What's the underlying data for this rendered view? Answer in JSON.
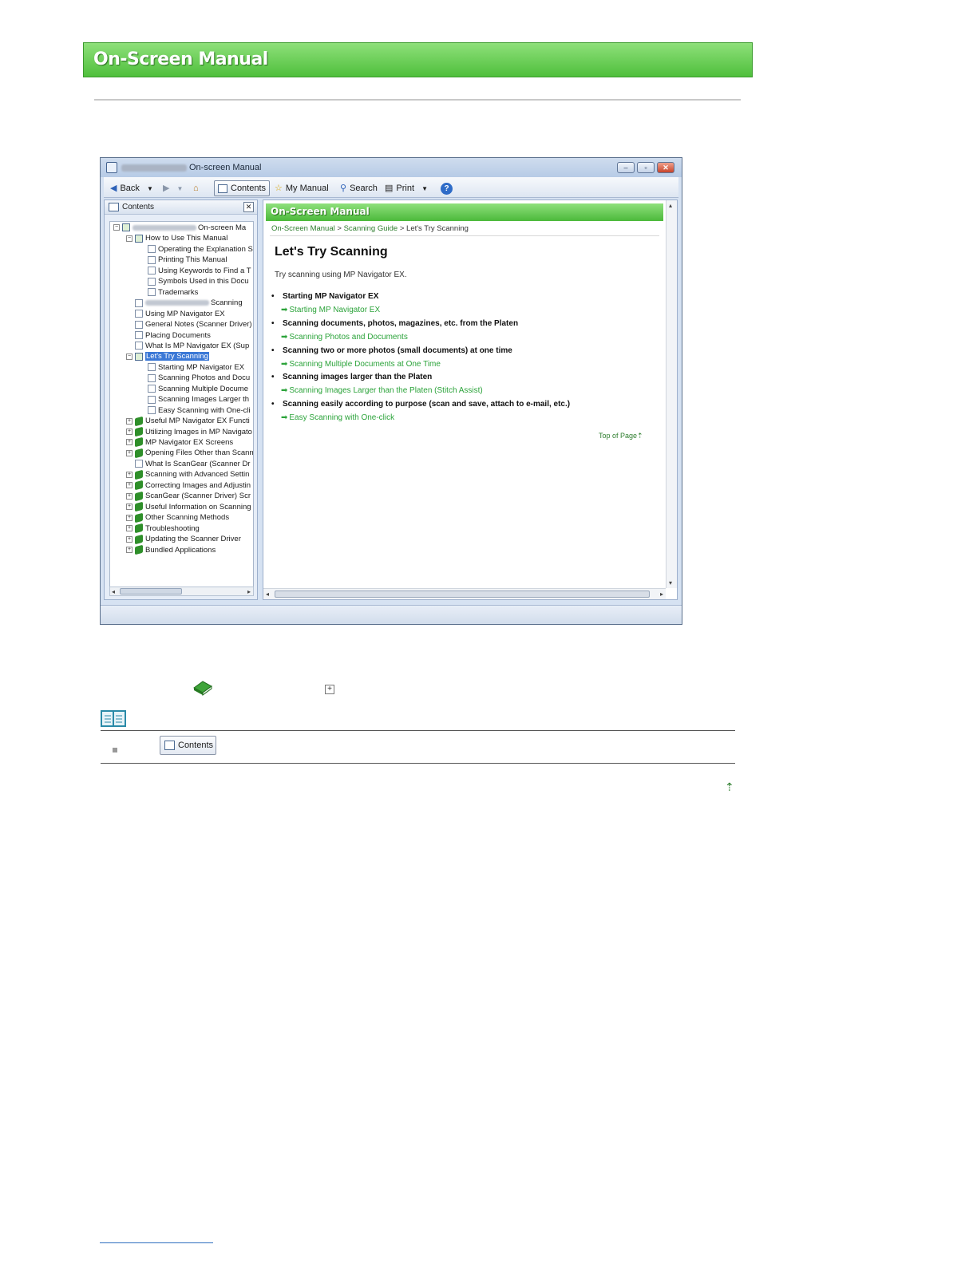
{
  "header": {
    "banner_title": "On-Screen Manual"
  },
  "window": {
    "title": "On-screen Manual",
    "toolbar": {
      "back": "Back",
      "contents": "Contents",
      "my_manual": "My Manual",
      "search": "Search",
      "print": "Print"
    },
    "left_pane": {
      "title": "Contents",
      "tree": [
        {
          "label": "On-screen Ma",
          "level": 0,
          "icon": "book-open",
          "expander": "minus",
          "blurred_prefix": true
        },
        {
          "label": "How to Use This Manual",
          "level": 1,
          "icon": "book-open",
          "expander": "minus"
        },
        {
          "label": "Operating the Explanation S",
          "level": 2,
          "icon": "page"
        },
        {
          "label": "Printing This Manual",
          "level": 2,
          "icon": "page"
        },
        {
          "label": "Using Keywords to Find a T",
          "level": 2,
          "icon": "page"
        },
        {
          "label": "Symbols Used in this Docu",
          "level": 2,
          "icon": "page"
        },
        {
          "label": "Trademarks",
          "level": 2,
          "icon": "page"
        },
        {
          "label": "Scanning",
          "level": 1,
          "icon": "page",
          "blurred_prefix": true
        },
        {
          "label": "Using MP Navigator EX",
          "level": 1,
          "icon": "page"
        },
        {
          "label": "General Notes (Scanner Driver)",
          "level": 1,
          "icon": "page"
        },
        {
          "label": "Placing Documents",
          "level": 1,
          "icon": "page"
        },
        {
          "label": "What Is MP Navigator EX (Sup",
          "level": 1,
          "icon": "page"
        },
        {
          "label": "Let's Try Scanning",
          "level": 1,
          "icon": "book-open",
          "expander": "minus",
          "selected": true
        },
        {
          "label": "Starting MP Navigator EX",
          "level": 2,
          "icon": "page"
        },
        {
          "label": "Scanning Photos and Docu",
          "level": 2,
          "icon": "page"
        },
        {
          "label": "Scanning Multiple Docume",
          "level": 2,
          "icon": "page"
        },
        {
          "label": "Scanning Images Larger th",
          "level": 2,
          "icon": "page"
        },
        {
          "label": "Easy Scanning with One-cli",
          "level": 2,
          "icon": "page"
        },
        {
          "label": "Useful MP Navigator EX Functi",
          "level": 1,
          "icon": "book-green",
          "expander": "plus"
        },
        {
          "label": "Utilizing Images in MP Navigato",
          "level": 1,
          "icon": "book-green",
          "expander": "plus"
        },
        {
          "label": "MP Navigator EX Screens",
          "level": 1,
          "icon": "book-green",
          "expander": "plus"
        },
        {
          "label": "Opening Files Other than Scann",
          "level": 1,
          "icon": "book-green",
          "expander": "plus"
        },
        {
          "label": "What Is ScanGear (Scanner Dr",
          "level": 1,
          "icon": "page"
        },
        {
          "label": "Scanning with Advanced Settin",
          "level": 1,
          "icon": "book-green",
          "expander": "plus"
        },
        {
          "label": "Correcting Images and Adjustin",
          "level": 1,
          "icon": "book-green",
          "expander": "plus"
        },
        {
          "label": "ScanGear (Scanner Driver) Scr",
          "level": 1,
          "icon": "book-green",
          "expander": "plus"
        },
        {
          "label": "Useful Information on Scanning",
          "level": 1,
          "icon": "book-green",
          "expander": "plus"
        },
        {
          "label": "Other Scanning Methods",
          "level": 1,
          "icon": "book-green",
          "expander": "plus"
        },
        {
          "label": "Troubleshooting",
          "level": 1,
          "icon": "book-green",
          "expander": "plus"
        },
        {
          "label": "Updating the Scanner Driver",
          "level": 1,
          "icon": "book-green",
          "expander": "plus"
        },
        {
          "label": "Bundled Applications",
          "level": 1,
          "icon": "book-green",
          "expander": "plus"
        }
      ]
    },
    "right_pane": {
      "banner": "On-Screen Manual",
      "breadcrumb": {
        "part1": "On-Screen Manual",
        "part2": "Scanning Guide",
        "current": "Let's Try Scanning",
        "sep": ">"
      },
      "heading": "Let's Try Scanning",
      "intro": "Try scanning using MP Navigator EX.",
      "items": [
        {
          "bullet": "Starting MP Navigator EX",
          "link": "Starting MP Navigator EX"
        },
        {
          "bullet": "Scanning documents, photos, magazines, etc. from the Platen",
          "link": "Scanning Photos and Documents"
        },
        {
          "bullet": "Scanning two or more photos (small documents) at one time",
          "link": "Scanning Multiple Documents at One Time"
        },
        {
          "bullet": "Scanning images larger than the Platen",
          "link": "Scanning Images Larger than the Platen (Stitch Assist)"
        },
        {
          "bullet": "Scanning easily according to purpose (scan and save, attach to e-mail, etc.)",
          "link": "Easy Scanning with One-click"
        }
      ],
      "top_of_page": "Top of Page"
    }
  },
  "note": {
    "contents_button": "Contents"
  },
  "colors": {
    "banner_green": "#4fbf3c",
    "link_green": "#2ba33a"
  }
}
